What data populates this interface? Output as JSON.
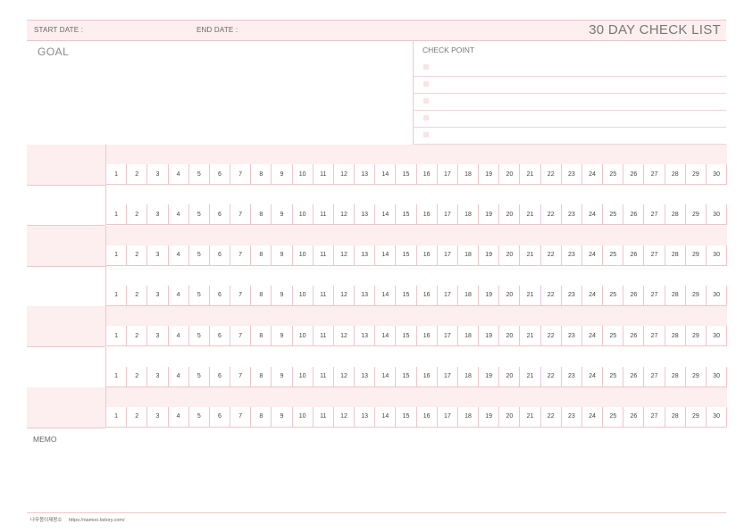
{
  "header": {
    "start_date_label": "START DATE :",
    "end_date_label": "END DATE :",
    "title": "30 DAY CHECK LIST"
  },
  "goal": {
    "label": "GOAL"
  },
  "check_point": {
    "label": "CHECK POINT",
    "items": 5
  },
  "tracker": {
    "rows": 7,
    "days": [
      "1",
      "2",
      "3",
      "4",
      "5",
      "6",
      "7",
      "8",
      "9",
      "10",
      "11",
      "12",
      "13",
      "14",
      "15",
      "16",
      "17",
      "18",
      "19",
      "20",
      "21",
      "22",
      "23",
      "24",
      "25",
      "26",
      "27",
      "28",
      "29",
      "30"
    ]
  },
  "memo": {
    "label": "MEMO"
  },
  "footer": {
    "brand": "나무뭉이제왕소",
    "url": "https://namoo.tistory.com/"
  },
  "colors": {
    "accent_pink": "#fdeef0",
    "line_pink": "#f0c5cb"
  }
}
